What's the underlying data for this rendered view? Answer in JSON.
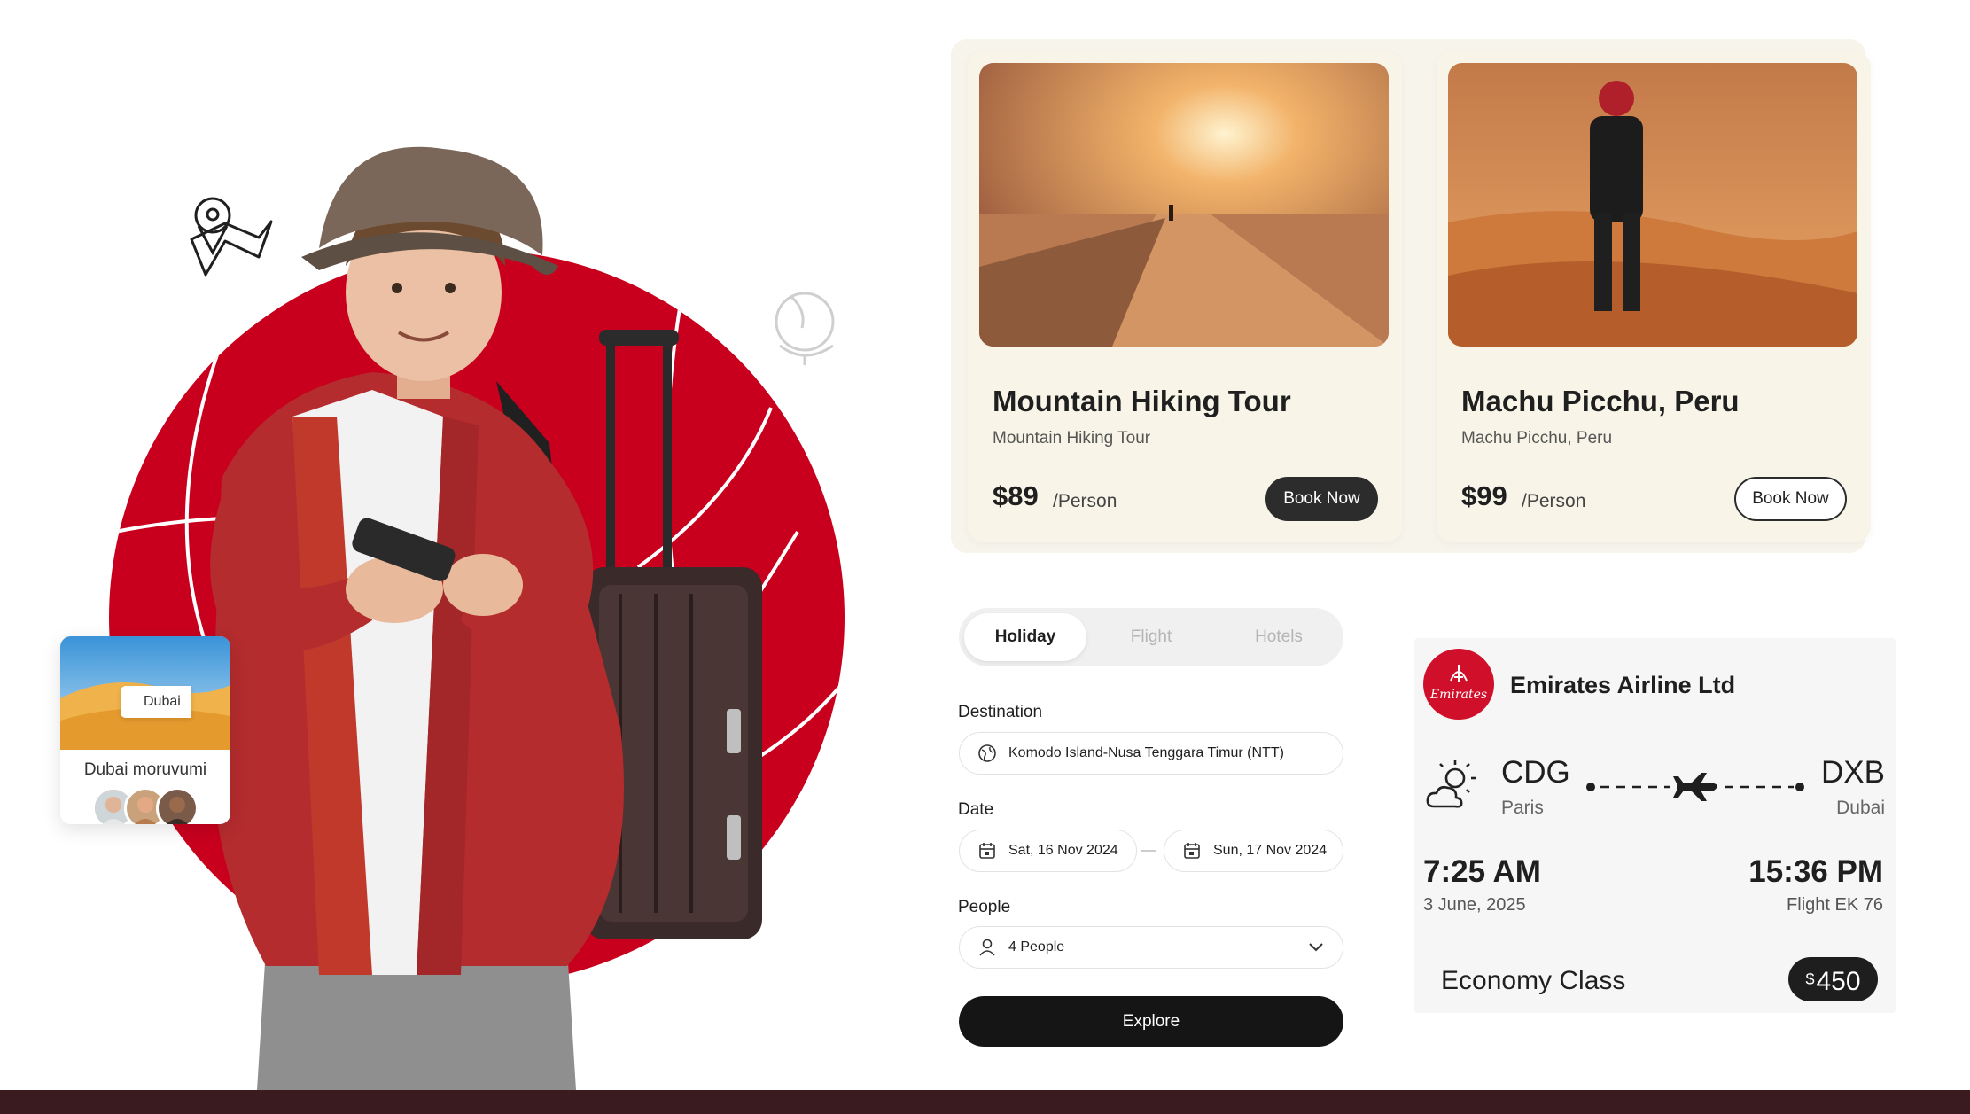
{
  "colors": {
    "brand_red": "#d0102a",
    "dark": "#1f1f1f",
    "card_bg": "#f8f5e8",
    "footer": "#3a1b1f"
  },
  "hero": {
    "icons": [
      "map-pin-icon",
      "globe-icon"
    ],
    "dubai_card": {
      "tag": "Dubai",
      "name": "Dubai moruvumi"
    }
  },
  "tours": [
    {
      "title": "Mountain Hiking Tour",
      "subtitle": "Mountain Hiking Tour",
      "price": "$89",
      "per": "/Person",
      "button": "Book Now"
    },
    {
      "title": "Machu Picchu, Peru",
      "subtitle": "Machu Picchu, Peru",
      "price": "$99",
      "per": "/Person",
      "button": "Book Now"
    }
  ],
  "search": {
    "tabs": [
      "Holiday",
      "Flight",
      "Hotels"
    ],
    "active_tab": "Holiday",
    "destination_label": "Destination",
    "destination_value": "Komodo Island-Nusa Tenggara Timur (NTT)",
    "date_label": "Date",
    "date_from": "Sat, 16 Nov 2024",
    "date_to": "Sun, 17 Nov 2024",
    "people_label": "People",
    "people_value": "4 People",
    "explore_button": "Explore"
  },
  "ticket": {
    "airline": "Emirates Airline Ltd",
    "logo_text": "Emirates",
    "from_code": "CDG",
    "from_city": "Paris",
    "to_code": "DXB",
    "to_city": "Dubai",
    "depart_time": "7:25 AM",
    "depart_date": "3 June, 2025",
    "arrive_time": "15:36 PM",
    "flight": "Flight EK 76",
    "class": "Economy Class",
    "currency": "$",
    "price": "450"
  }
}
